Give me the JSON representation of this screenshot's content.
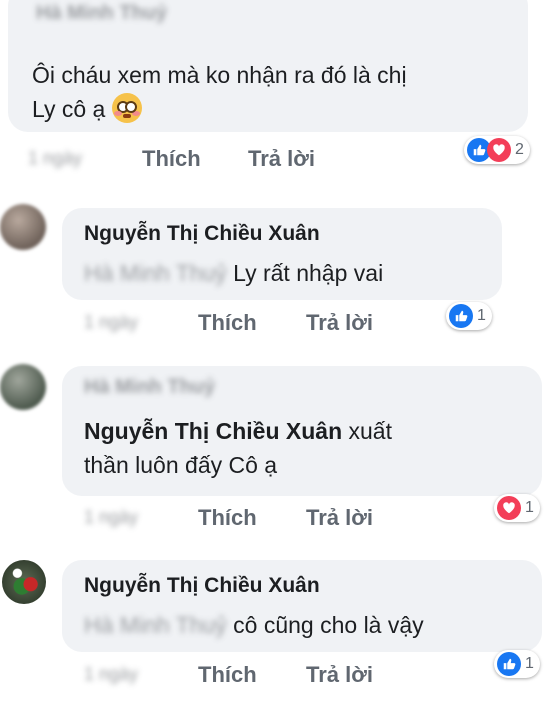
{
  "comments": [
    {
      "author_blurred": "Hà Minh Thuỷ",
      "text_line1": "Ôi cháu xem mà ko nhận ra đó là chị",
      "text_line2": "Ly cô ạ",
      "emoji": "flushed-face",
      "time_blurred": "1 ngày",
      "like_label": "Thích",
      "reply_label": "Trả lời",
      "reaction_count": "2",
      "reactions": [
        "like",
        "love"
      ]
    },
    {
      "author": "Nguyễn Thị Chiều Xuân",
      "mention_blurred": "Hà Minh Thuỷ",
      "text": "Ly rất nhập vai",
      "time_blurred": "1 ngày",
      "like_label": "Thích",
      "reply_label": "Trả lời",
      "reaction_count": "1",
      "reactions": [
        "like"
      ]
    },
    {
      "author_blurred": "Hà Minh Thuỷ",
      "mention": "Nguyễn Thị Chiều Xuân",
      "text_line1": "xuất",
      "text_line2": "thần luôn đấy Cô ạ",
      "time_blurred": "1 ngày",
      "like_label": "Thích",
      "reply_label": "Trả lời",
      "reaction_count": "1",
      "reactions": [
        "love"
      ]
    },
    {
      "author": "Nguyễn Thị Chiều Xuân",
      "mention_blurred": "Hà Minh Thuỷ",
      "text": "cô cũng cho là vậy",
      "time_blurred": "1 ngày",
      "like_label": "Thích",
      "reply_label": "Trả lời",
      "reaction_count": "1",
      "reactions": [
        "like"
      ]
    }
  ],
  "colors": {
    "like": "#1877f2",
    "love": "#f33e58",
    "bubble": "#f0f2f5",
    "action_text": "#606770"
  }
}
